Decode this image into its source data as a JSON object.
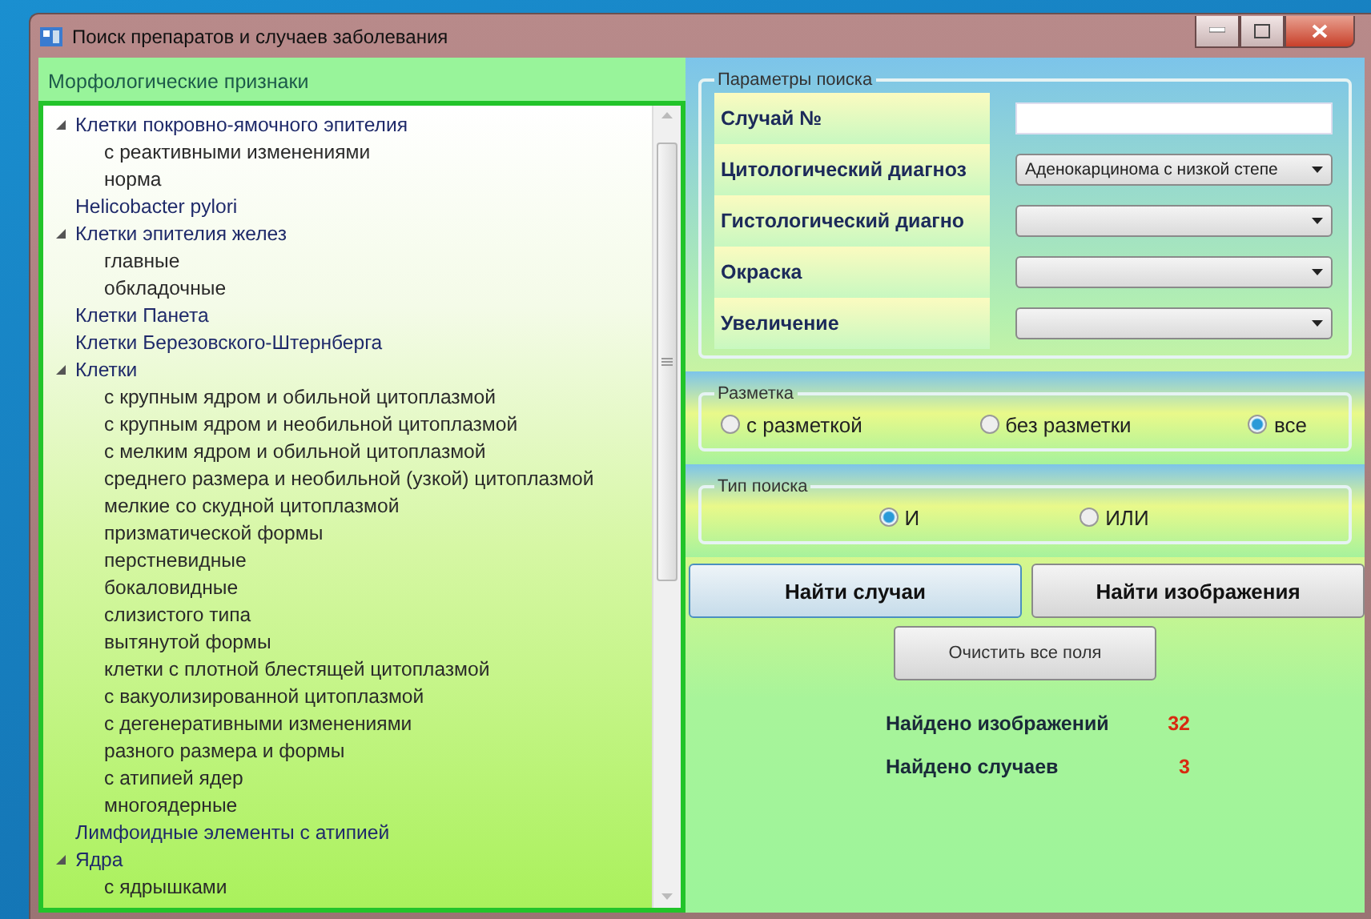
{
  "window": {
    "title": "Поиск препаратов и случаев заболевания"
  },
  "left_panel": {
    "title": "Морфологические признаки",
    "tree": [
      {
        "label": "Клетки покровно-ямочного эпителия",
        "expanded": true,
        "children": [
          {
            "label": "с реактивными изменениями"
          },
          {
            "label": "норма"
          }
        ]
      },
      {
        "label": "Helicobacter pylori"
      },
      {
        "label": "Клетки эпителия желез",
        "expanded": true,
        "children": [
          {
            "label": "главные"
          },
          {
            "label": "обкладочные"
          }
        ]
      },
      {
        "label": "Клетки Панета"
      },
      {
        "label": "Клетки Березовского-Штернберга"
      },
      {
        "label": "Клетки",
        "expanded": true,
        "children": [
          {
            "label": "с крупным ядром и обильной цитоплазмой"
          },
          {
            "label": "с крупным ядром и необильной цитоплазмой"
          },
          {
            "label": "с мелким ядром и обильной цитоплазмой"
          },
          {
            "label": "среднего размера и необильной (узкой) цитоплазмой"
          },
          {
            "label": "мелкие со скудной цитоплазмой"
          },
          {
            "label": "призматической формы"
          },
          {
            "label": "перстневидные"
          },
          {
            "label": "бокаловидные"
          },
          {
            "label": "слизистого типа"
          },
          {
            "label": "вытянутой формы"
          },
          {
            "label": "клетки с плотной блестящей цитоплазмой"
          },
          {
            "label": "с вакуолизированной цитоплазмой"
          },
          {
            "label": "с дегенеративными изменениями"
          },
          {
            "label": "разного размера и формы"
          },
          {
            "label": "с атипией ядер"
          },
          {
            "label": "многоядерные"
          }
        ]
      },
      {
        "label": "Лимфоидные элементы с атипией"
      },
      {
        "label": "Ядра",
        "expanded": true,
        "children": [
          {
            "label": "с ядрышками"
          }
        ]
      }
    ]
  },
  "search_params": {
    "title": "Параметры поиска",
    "fields": [
      {
        "label": "Случай №",
        "kind": "text"
      },
      {
        "label": "Цитологический диагноз",
        "kind": "combo",
        "value": "Аденокарцинома с низкой степе"
      },
      {
        "label": "Гистологический диагно",
        "kind": "combo"
      },
      {
        "label": "Окраска",
        "kind": "combo"
      },
      {
        "label": "Увеличение",
        "kind": "combo"
      }
    ]
  },
  "markup": {
    "title": "Разметка",
    "options": [
      {
        "label": "с разметкой",
        "selected": false
      },
      {
        "label": "без разметки",
        "selected": false
      },
      {
        "label": "все",
        "selected": true
      }
    ]
  },
  "search_type": {
    "title": "Тип поиска",
    "options": [
      {
        "label": "И",
        "selected": true
      },
      {
        "label": "ИЛИ",
        "selected": false
      }
    ]
  },
  "buttons": [
    {
      "label": "Найти случаи",
      "focused": true
    },
    {
      "label": "Найти изображения",
      "focused": false
    }
  ],
  "clear_button": "Очистить все поля",
  "results": [
    {
      "label": "Найдено изображений",
      "value": "32"
    },
    {
      "label": "Найдено случаев",
      "value": "3"
    }
  ]
}
